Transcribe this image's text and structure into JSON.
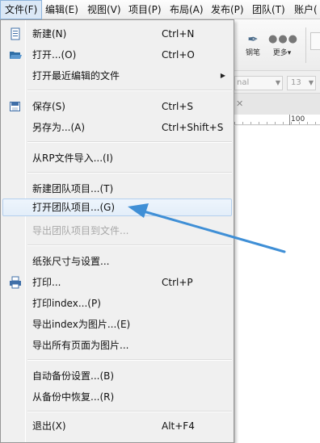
{
  "menubar": {
    "items": [
      {
        "label": "文件(F)"
      },
      {
        "label": "编辑(E)"
      },
      {
        "label": "视图(V)"
      },
      {
        "label": "项目(P)"
      },
      {
        "label": "布局(A)"
      },
      {
        "label": "发布(P)"
      },
      {
        "label": "团队(T)"
      },
      {
        "label": "账户("
      }
    ]
  },
  "toolbar": {
    "pen_label": "钢笔",
    "more_label": "更多▾"
  },
  "format": {
    "font_value": "nal",
    "font_size": "13"
  },
  "ruler": {
    "mark": "100"
  },
  "file_menu": {
    "new": {
      "label": "新建(N)",
      "shortcut": "Ctrl+N"
    },
    "open": {
      "label": "打开...(O)",
      "shortcut": "Ctrl+O"
    },
    "recent": {
      "label": "打开最近编辑的文件"
    },
    "save": {
      "label": "保存(S)",
      "shortcut": "Ctrl+S"
    },
    "save_as": {
      "label": "另存为...(A)",
      "shortcut": "Ctrl+Shift+S"
    },
    "import_rp": {
      "label": "从RP文件导入...(I)"
    },
    "new_team": {
      "label": "新建团队项目...(T)"
    },
    "open_team": {
      "label": "打开团队项目...(G)"
    },
    "export_team": {
      "label": "导出团队项目到文件..."
    },
    "page_setup": {
      "label": "纸张尺寸与设置..."
    },
    "print": {
      "label": "打印...",
      "shortcut": "Ctrl+P"
    },
    "print_index": {
      "label": "打印index...(P)"
    },
    "export_index_img": {
      "label": "导出index为图片...(E)"
    },
    "export_all_img": {
      "label": "导出所有页面为图片..."
    },
    "autobackup": {
      "label": "自动备份设置...(B)"
    },
    "restore_backup": {
      "label": "从备份中恢复...(R)"
    },
    "exit": {
      "label": "退出(X)",
      "shortcut": "Alt+F4"
    }
  },
  "colors": {
    "hover_bg": "#e3eef9",
    "annotation_arrow": "#3f8fd6"
  }
}
